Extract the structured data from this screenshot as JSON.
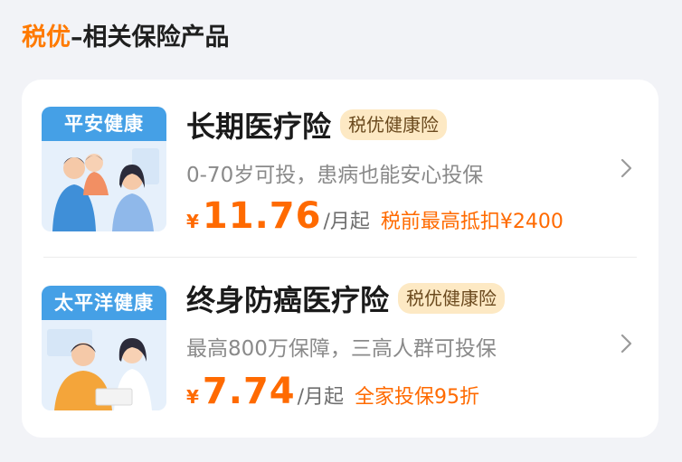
{
  "section": {
    "title_accent": "税优",
    "title_rest": "–相关保险产品"
  },
  "products": [
    {
      "brand": "平安健康",
      "name": "长期医疗险",
      "badge": "税优健康险",
      "description": "0-70岁可投，患病也能安心投保",
      "currency": "¥",
      "price": "11.76",
      "unit": "/月起",
      "promo": "税前最高抵扣¥2400",
      "thumb_icon": "family-illustration"
    },
    {
      "brand": "太平洋健康",
      "name": "终身防癌医疗险",
      "badge": "税优健康险",
      "description": "最高800万保障，三高人群可投保",
      "currency": "¥",
      "price": "7.74",
      "unit": "/月起",
      "promo": "全家投保95折",
      "thumb_icon": "couple-illustration"
    }
  ],
  "colors": {
    "accent": "#ff6a00",
    "badge_bg": "#fde9c4",
    "brand_banner": "#45a0e6"
  }
}
